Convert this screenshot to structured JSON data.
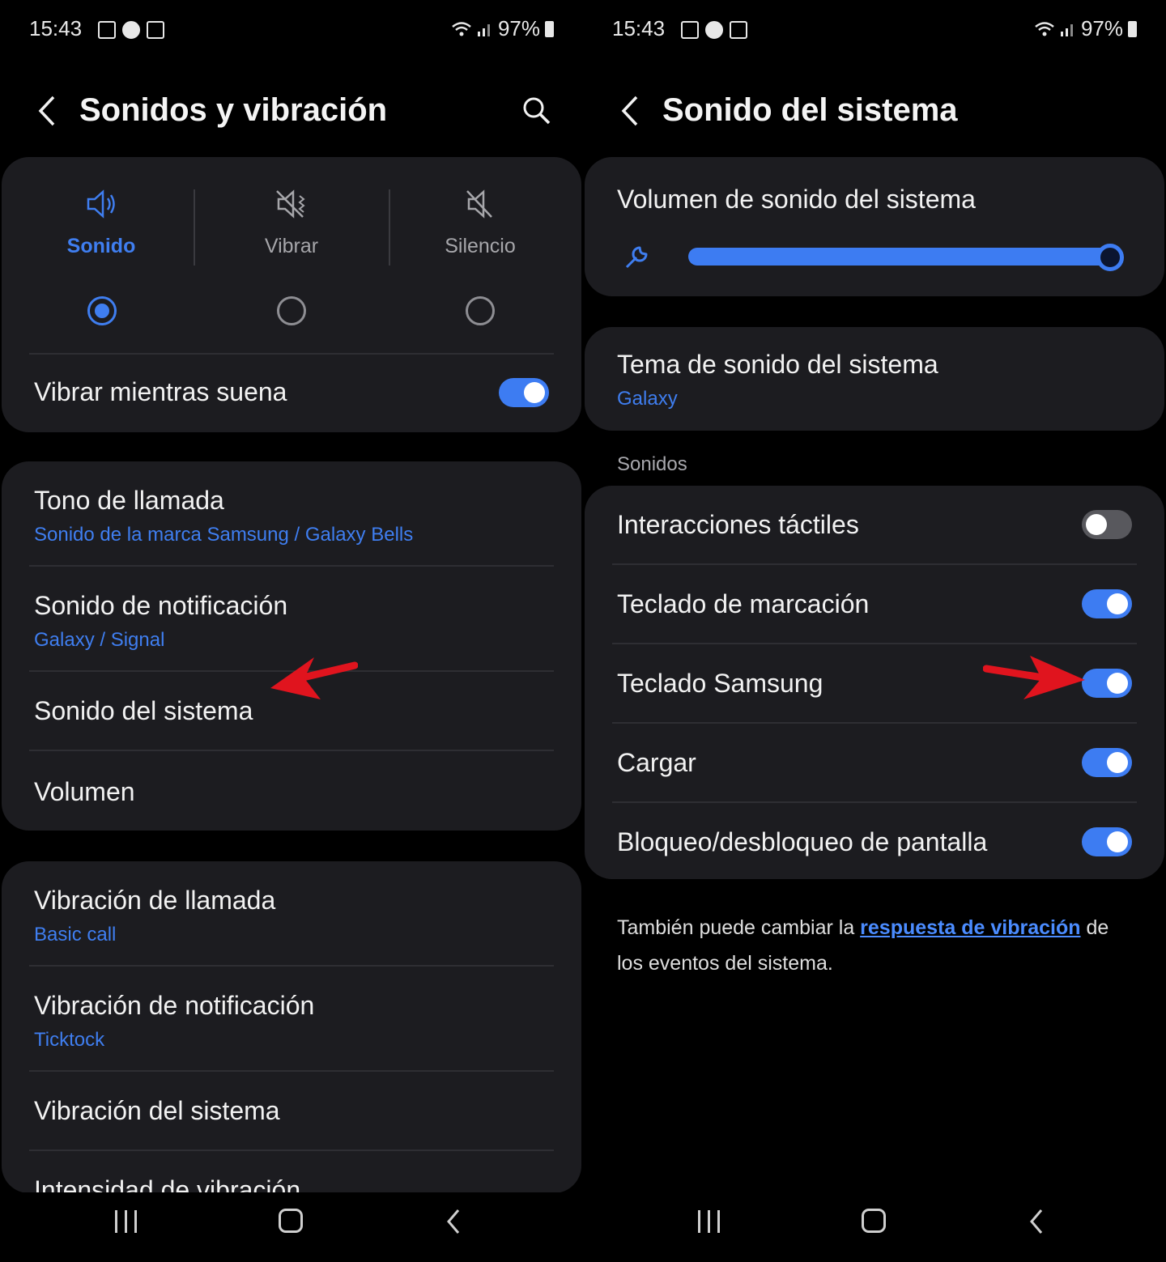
{
  "status_bar": {
    "time": "15:43",
    "battery": "97%"
  },
  "left": {
    "title": "Sonidos y vibración",
    "modes": [
      {
        "label": "Sonido",
        "selected": true,
        "icon": "speaker-icon"
      },
      {
        "label": "Vibrar",
        "selected": false,
        "icon": "vibrate-icon"
      },
      {
        "label": "Silencio",
        "selected": false,
        "icon": "mute-icon"
      }
    ],
    "vibrate_while_ringing": {
      "label": "Vibrar mientras suena",
      "on": true
    },
    "sound_items": [
      {
        "title": "Tono de llamada",
        "subtitle": "Sonido de la marca Samsung / Galaxy Bells"
      },
      {
        "title": "Sonido de notificación",
        "subtitle": "Galaxy / Signal"
      },
      {
        "title": "Sonido del sistema"
      },
      {
        "title": "Volumen"
      }
    ],
    "vibration_items": [
      {
        "title": "Vibración de llamada",
        "subtitle": "Basic call"
      },
      {
        "title": "Vibración de notificación",
        "subtitle": "Ticktock"
      },
      {
        "title": "Vibración del sistema"
      },
      {
        "title": "Intensidad de vibración"
      }
    ]
  },
  "right": {
    "title": "Sonido del sistema",
    "volume": {
      "label": "Volumen de sonido del sistema",
      "level": 1.0
    },
    "theme": {
      "title": "Tema de sonido del sistema",
      "subtitle": "Galaxy"
    },
    "section_label": "Sonidos",
    "toggles": [
      {
        "label": "Interacciones táctiles",
        "on": false
      },
      {
        "label": "Teclado de marcación",
        "on": true
      },
      {
        "label": "Teclado Samsung",
        "on": true
      },
      {
        "label": "Cargar",
        "on": true
      },
      {
        "label": "Bloqueo/desbloqueo de pantalla",
        "on": true
      }
    ],
    "note": {
      "prefix": "También puede cambiar la ",
      "link": "respuesta de vibración",
      "suffix": " de los eventos del sistema."
    }
  },
  "colors": {
    "accent": "#3d7cf2",
    "card": "#1c1c20",
    "annotation_arrow": "#e0141e"
  }
}
